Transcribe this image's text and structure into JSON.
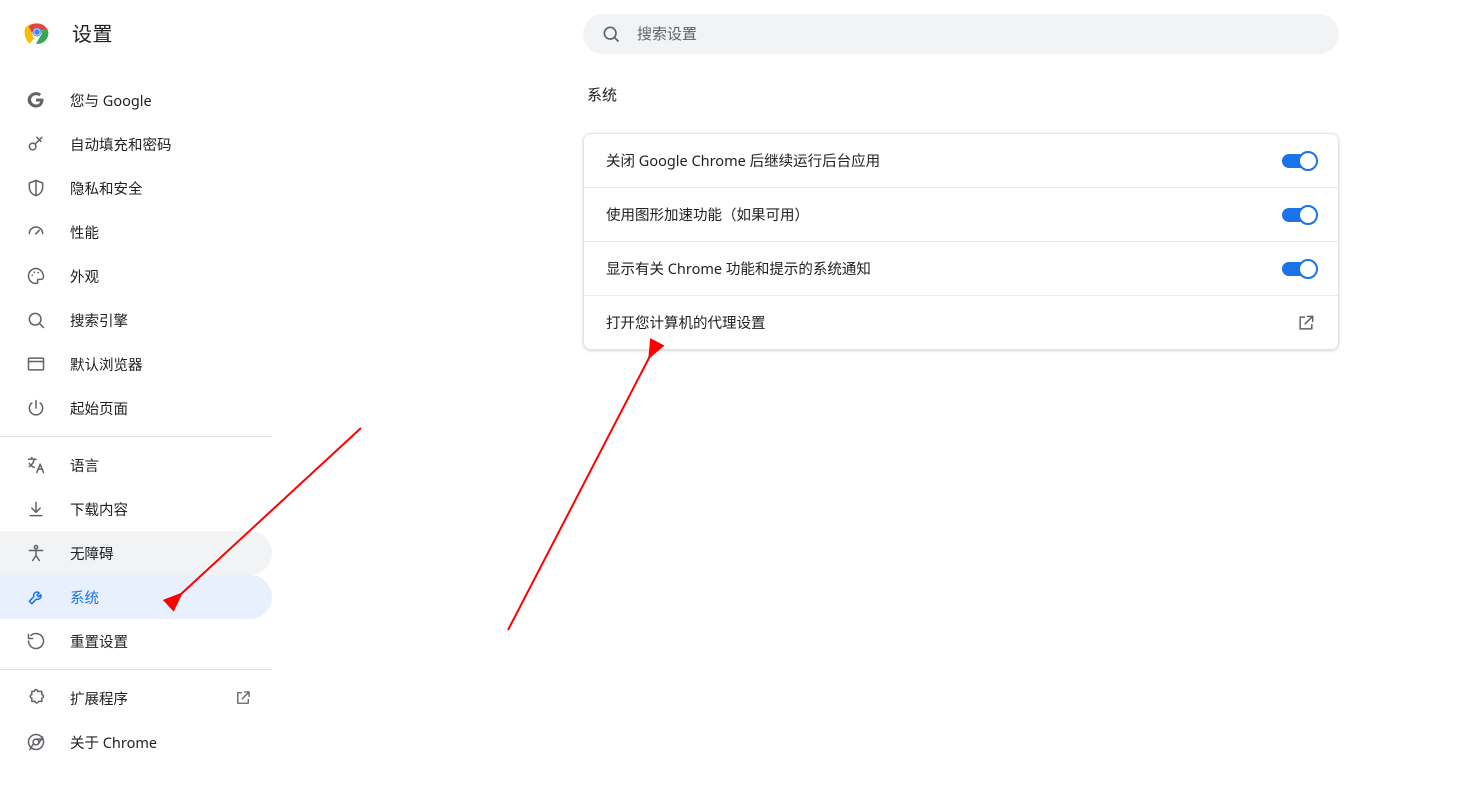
{
  "header": {
    "title": "设置"
  },
  "search": {
    "placeholder": "搜索设置"
  },
  "sidebar": {
    "groups": [
      [
        {
          "id": "you-google",
          "icon": "google",
          "label": "您与 Google"
        },
        {
          "id": "autofill",
          "icon": "key",
          "label": "自动填充和密码"
        },
        {
          "id": "privacy",
          "icon": "shield",
          "label": "隐私和安全"
        },
        {
          "id": "performance",
          "icon": "speed",
          "label": "性能"
        },
        {
          "id": "appearance",
          "icon": "palette",
          "label": "外观"
        },
        {
          "id": "search-engine",
          "icon": "search",
          "label": "搜索引擎"
        },
        {
          "id": "default-browser",
          "icon": "window",
          "label": "默认浏览器"
        },
        {
          "id": "on-startup",
          "icon": "power",
          "label": "起始页面"
        }
      ],
      [
        {
          "id": "languages",
          "icon": "translate",
          "label": "语言"
        },
        {
          "id": "downloads",
          "icon": "download",
          "label": "下载内容"
        },
        {
          "id": "accessibility",
          "icon": "accessibility",
          "label": "无障碍",
          "hovered": true
        },
        {
          "id": "system",
          "icon": "wrench",
          "label": "系统",
          "selected": true
        },
        {
          "id": "reset",
          "icon": "restore",
          "label": "重置设置"
        }
      ],
      [
        {
          "id": "extensions",
          "icon": "puzzle",
          "label": "扩展程序",
          "external": true
        },
        {
          "id": "about",
          "icon": "chrome-outline",
          "label": "关于 Chrome"
        }
      ]
    ]
  },
  "section": {
    "title": "系统",
    "rows": [
      {
        "type": "toggle",
        "label": "关闭 Google Chrome 后继续运行后台应用",
        "value": true
      },
      {
        "type": "toggle",
        "label": "使用图形加速功能（如果可用）",
        "value": true
      },
      {
        "type": "toggle",
        "label": "显示有关 Chrome 功能和提示的系统通知",
        "value": true
      },
      {
        "type": "link",
        "label": "打开您计算机的代理设置"
      }
    ]
  },
  "colors": {
    "accent": "#1a73e8",
    "annotation": "#ff0000"
  }
}
